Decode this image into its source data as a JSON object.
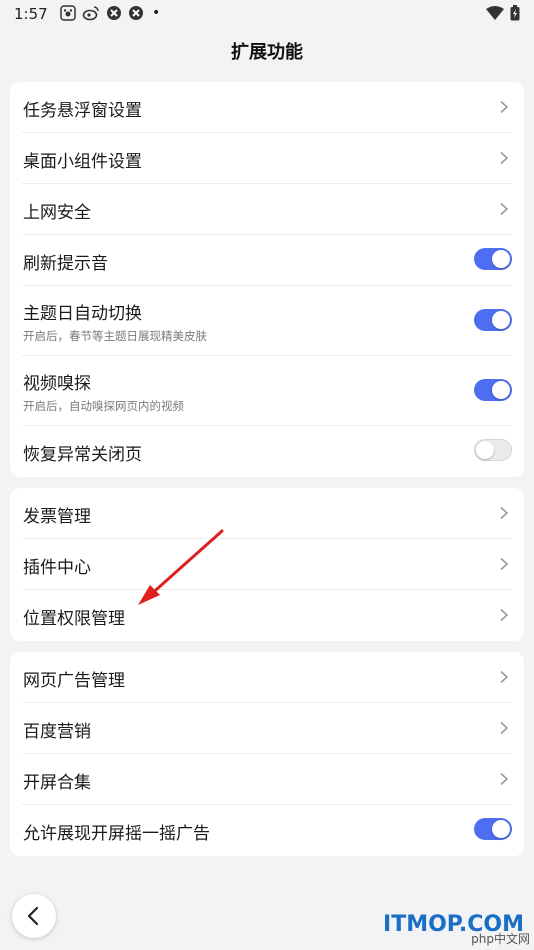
{
  "status_bar": {
    "time": "1:57",
    "dot": "•",
    "icons": [
      "baidu-paw-icon",
      "weibo-icon",
      "app-icon",
      "app-icon",
      "wifi-icon",
      "battery-icon"
    ]
  },
  "page": {
    "title": "扩展功能"
  },
  "groups": [
    {
      "items": [
        {
          "label": "任务悬浮窗设置",
          "control": "chevron"
        },
        {
          "label": "桌面小组件设置",
          "control": "chevron"
        },
        {
          "label": "上网安全",
          "control": "chevron"
        },
        {
          "label": "刷新提示音",
          "control": "toggle",
          "on": true
        },
        {
          "label": "主题日自动切换",
          "sub": "开启后，春节等主题日展现精美皮肤",
          "control": "toggle",
          "on": true
        },
        {
          "label": "视频嗅探",
          "sub": "开启后，自动嗅探网页内的视频",
          "control": "toggle",
          "on": true
        },
        {
          "label": "恢复异常关闭页",
          "control": "toggle",
          "on": false
        }
      ]
    },
    {
      "items": [
        {
          "label": "发票管理",
          "control": "chevron"
        },
        {
          "label": "插件中心",
          "control": "chevron"
        },
        {
          "label": "位置权限管理",
          "control": "chevron"
        }
      ]
    },
    {
      "items": [
        {
          "label": "网页广告管理",
          "control": "chevron"
        },
        {
          "label": "百度营销",
          "control": "chevron"
        },
        {
          "label": "开屏合集",
          "control": "chevron"
        },
        {
          "label": "允许展现开屏摇一摇广告",
          "control": "toggle",
          "on": true
        }
      ]
    }
  ],
  "watermark": {
    "text": "ITMOP.COM",
    "sub": "php中文网"
  },
  "colors": {
    "accent": "#4e6ef2",
    "annotation_arrow": "#e02020"
  }
}
